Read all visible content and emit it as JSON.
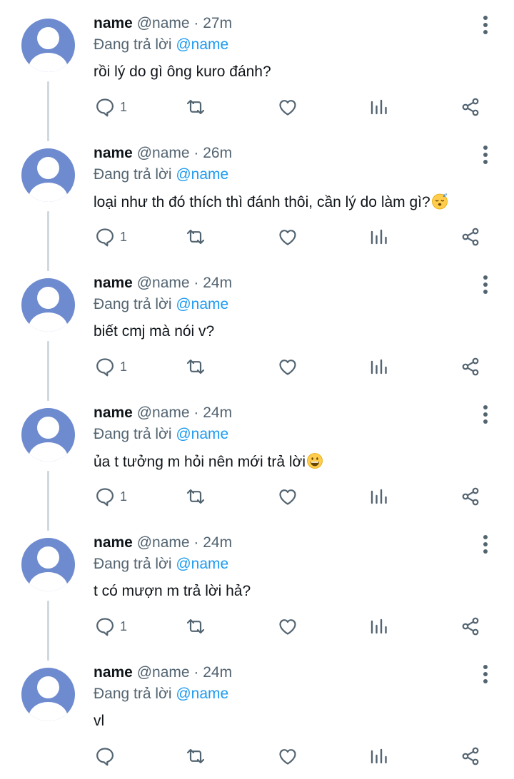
{
  "tweets": [
    {
      "name": "name",
      "handle": "@name",
      "separator": "·",
      "time": "27m",
      "replying_prefix": "Đang trả lời",
      "replying_to": "@name",
      "text": "rồi lý do gì ông kuro đánh?",
      "emoji": "",
      "reply_count": "1"
    },
    {
      "name": "name",
      "handle": "@name",
      "separator": "·",
      "time": "26m",
      "replying_prefix": "Đang trả lời",
      "replying_to": "@name",
      "text": "loại như th đó thích thì đánh thôi, cần lý do làm gì?",
      "emoji": "sleeping-face",
      "reply_count": "1"
    },
    {
      "name": "name",
      "handle": "@name",
      "separator": "·",
      "time": "24m",
      "replying_prefix": "Đang trả lời",
      "replying_to": "@name",
      "text": "biết cmj mà nói v?",
      "emoji": "",
      "reply_count": "1"
    },
    {
      "name": "name",
      "handle": "@name",
      "separator": "·",
      "time": "24m",
      "replying_prefix": "Đang trả lời",
      "replying_to": "@name",
      "text": "ủa t tưởng m hỏi nên mới trả lời",
      "emoji": "grinning-face",
      "reply_count": "1"
    },
    {
      "name": "name",
      "handle": "@name",
      "separator": "·",
      "time": "24m",
      "replying_prefix": "Đang trả lời",
      "replying_to": "@name",
      "text": "t có mượn m trả lời hả?",
      "emoji": "",
      "reply_count": "1"
    },
    {
      "name": "name",
      "handle": "@name",
      "separator": "·",
      "time": "24m",
      "replying_prefix": "Đang trả lời",
      "replying_to": "@name",
      "text": "vl",
      "emoji": "",
      "reply_count": ""
    }
  ],
  "icons": {
    "more": "more-vertical-icon",
    "reply": "reply-bubble-icon",
    "retweet": "retweet-icon",
    "like": "heart-icon",
    "views": "bar-chart-icon",
    "share": "share-nodes-icon"
  },
  "colors": {
    "avatar": "#6f8bd0",
    "mention": "#1d9bf0",
    "secondary_text": "#536471",
    "primary_text": "#0f1419",
    "thread_line": "#cfd9de",
    "icon": "#536471"
  }
}
